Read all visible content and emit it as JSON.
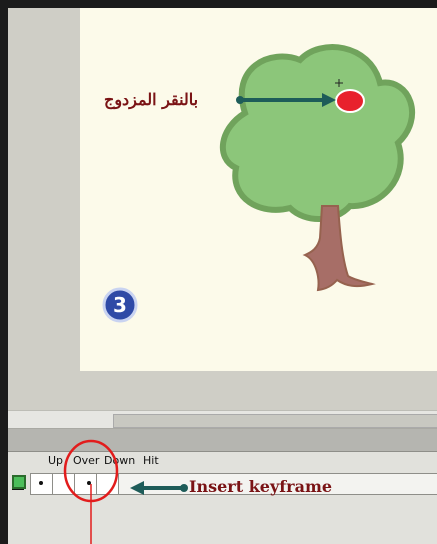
{
  "frame_labels": [
    "Up",
    "Over",
    "Down",
    "Hit"
  ],
  "arabic_callout": "بالنقر المزدوج",
  "step_number": "3",
  "keyframe_callout": "Insert keyframe",
  "colors": {
    "stage": "#fcfaea",
    "tree_foliage": "#8cc67a",
    "tree_outline": "#70a35c",
    "trunk": "#a76e67",
    "apple": "#e8212d",
    "arrow": "#1e5c59",
    "over_highlight": "#f28b86",
    "callout_text": "#7a1315",
    "badge": "#2f4aa6"
  }
}
